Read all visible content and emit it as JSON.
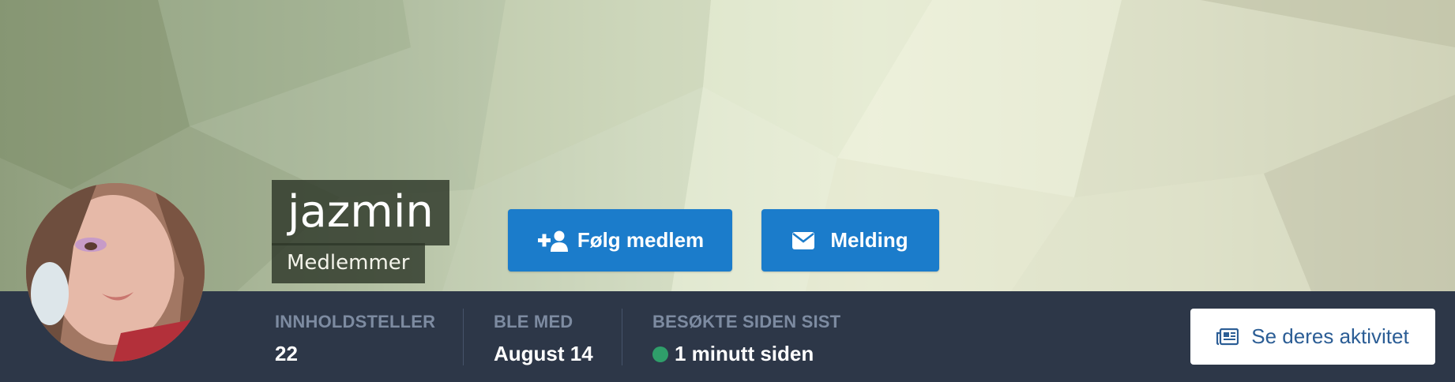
{
  "profile": {
    "username": "jazmin",
    "role": "Medlemmer",
    "avatar_icon": "user-photo"
  },
  "actions": {
    "follow_label": "Følg medlem",
    "follow_icon": "user-plus-icon",
    "message_label": "Melding",
    "message_icon": "envelope-icon",
    "activity_label": "Se deres aktivitet",
    "activity_icon": "newspaper-icon"
  },
  "stats": [
    {
      "label": "INNHOLDSTELLER",
      "value": "22"
    },
    {
      "label": "BLE MED",
      "value": "August 14"
    },
    {
      "label": "BESØKTE SIDEN SIST",
      "value": "1 minutt siden",
      "status_color": "#2f9e6a"
    }
  ],
  "colors": {
    "primary_button": "#1b7ccb",
    "bar_background": "#2d3748",
    "stat_label": "#7d8ba1",
    "activity_text": "#2b5d95"
  }
}
